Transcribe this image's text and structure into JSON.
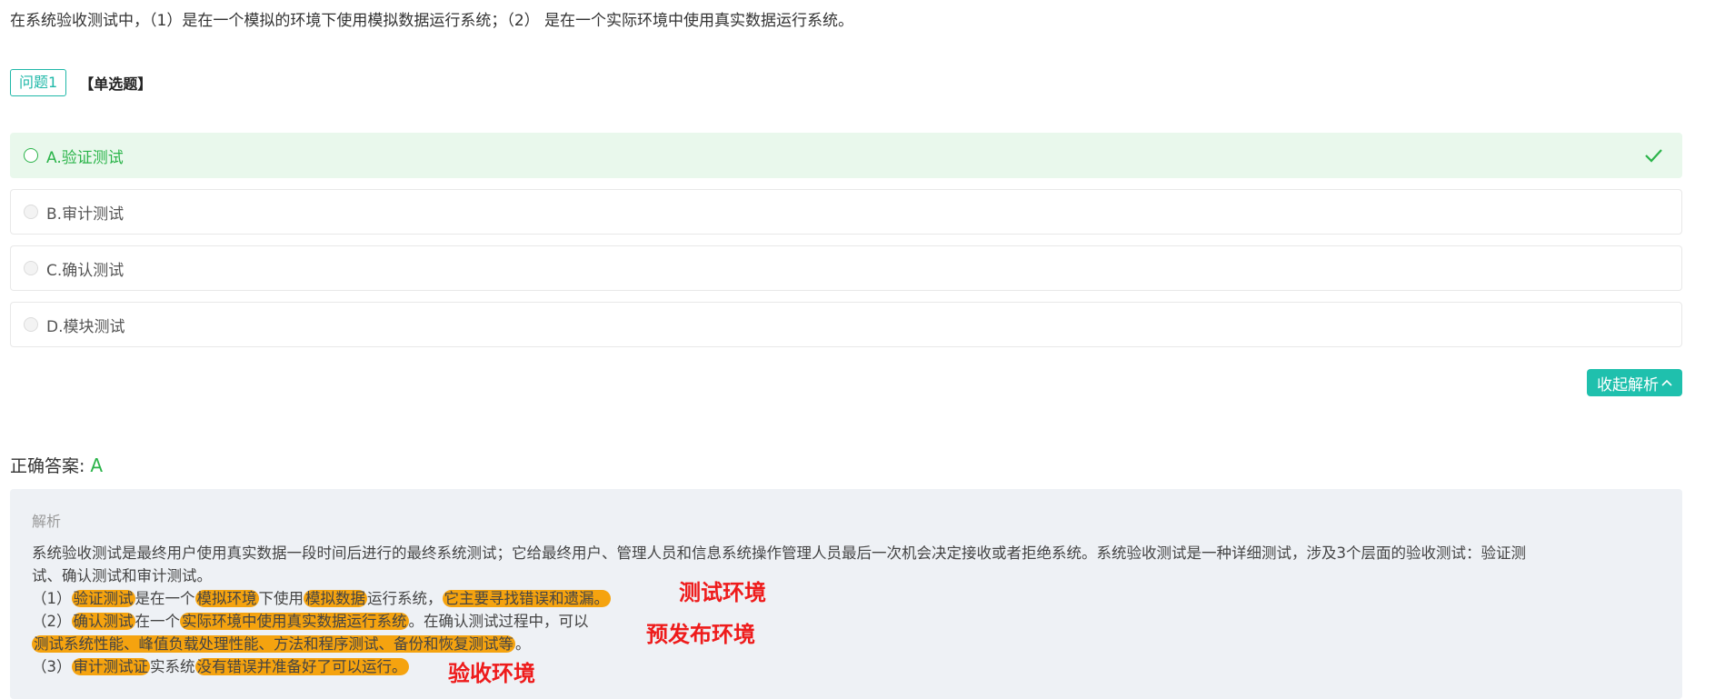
{
  "question": {
    "stem": "在系统验收测试中，（1）是在一个模拟的环境下使用模拟数据运行系统；（2） 是在一个实际环境中使用真实数据运行系统。",
    "tag": "问题1",
    "type": "【单选题】"
  },
  "options": [
    {
      "label": "A.验证测试",
      "correct": true
    },
    {
      "label": "B.审计测试",
      "correct": false
    },
    {
      "label": "C.确认测试",
      "correct": false
    },
    {
      "label": "D.模块测试",
      "correct": false
    }
  ],
  "collapse_button": "收起解析",
  "answer": {
    "label": "正确答案:",
    "value": "A"
  },
  "analysis": {
    "title": "解析",
    "para1": "系统验收测试是最终用户使用真实数据一段时间后进行的最终系统测试；它给最终用户、管理人员和信息系统操作管理人员最后一次机会决定接收或者拒绝系统。系统验收测试是一种详细测试，涉及3个层面的验收测试：验证测",
    "para2": "试、确认测试和审计测试。",
    "line1": {
      "a": "（1）",
      "b": "验证测试",
      "c": "是在一个",
      "d": "模拟环境",
      "e": "下使用",
      "f": "模拟数据",
      "g": "运行系统，",
      "h": "它主要寻找错误和遗漏。"
    },
    "line2": {
      "a": "（2）",
      "b": "确认测试",
      "c": "在一个",
      "d": "实际环境中使用真实数据运行系统",
      "e": "。在确认测试过程中，可以"
    },
    "line3": {
      "a": "测试系统性能、峰值负载处理性能、方法和程序测试、备份和恢复测试等",
      "b": "。"
    },
    "line4": {
      "a": "（3）",
      "b": "审计测试证",
      "c": "实系统",
      "d": "没有错误并准备好了可以运行。"
    }
  },
  "annotations": {
    "note1": "测试环境",
    "note2": "预发布环境",
    "note3": "验收环境"
  },
  "colors": {
    "accent": "#1fc0ad",
    "correct": "#2bb44a",
    "highlight": "#f5a30f",
    "note": "#ee1b1b"
  }
}
